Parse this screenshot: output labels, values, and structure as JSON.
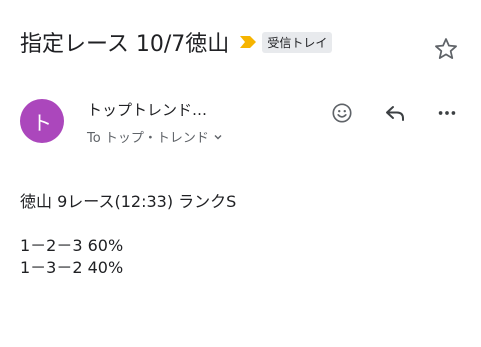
{
  "subject": "指定レース 10/7徳山",
  "label": {
    "name": "受信トレイ",
    "marker_color": "#f6b400"
  },
  "sender": {
    "avatar_letter": "ト",
    "avatar_color": "#ab47bc",
    "name": "トップトレンド…",
    "recipient": "To トップ・トレンド"
  },
  "icons": {
    "star": "star-outline-icon",
    "emoji": "emoji-icon",
    "reply": "reply-icon",
    "more": "more-horizontal-icon",
    "chevron": "chevron-down-icon"
  },
  "body": {
    "line1": "徳山 9レース(12:33) ランクS",
    "line2": "",
    "line3": "1－2－3  60%",
    "line4": "1－3－2  40%"
  }
}
